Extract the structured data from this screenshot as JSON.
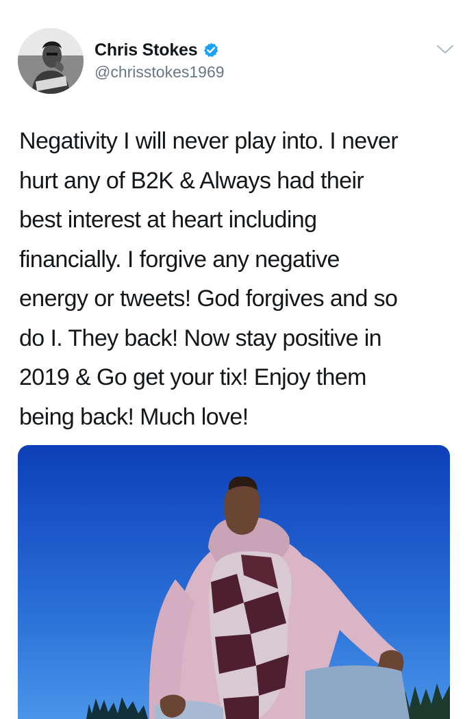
{
  "tweet": {
    "author": {
      "display_name": "Chris Stokes",
      "handle": "@chrisstokes1969",
      "verified": true,
      "avatar_icon": "avatar"
    },
    "menu_icon": "chevron-down-icon",
    "text": "Negativity I will never play into. I never\nhurt any of B2K & Always had their\nbest interest at heart including\nfinancially. I forgive any negative\nenergy or tweets! God forgives and so\ndo I. They back! Now stay positive in\n2019 & Go get your tix! Enjoy them\nbeing back! Much love!",
    "media": {
      "type": "photo"
    }
  },
  "colors": {
    "verified_blue": "#1da1f2",
    "handle_gray": "#657786",
    "text": "#14171a",
    "sky_top": "#0d3fb8",
    "sky_bottom": "#3a86e6"
  }
}
